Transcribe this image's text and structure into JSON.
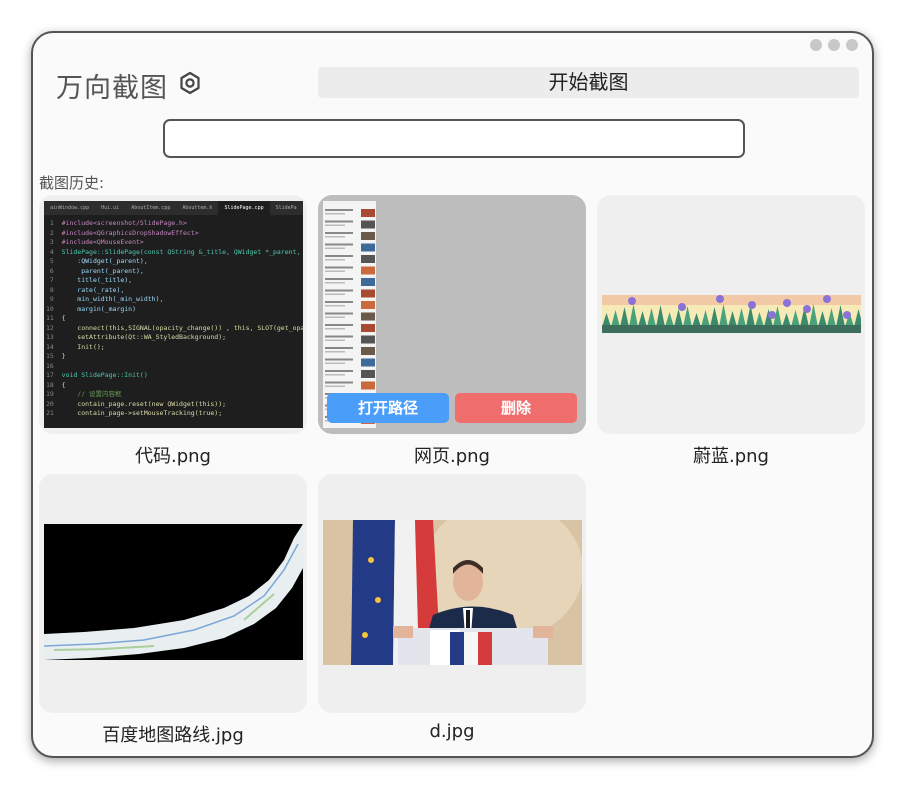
{
  "app": {
    "title": "万向截图"
  },
  "toolbar": {
    "start_label": "开始截图"
  },
  "search": {
    "value": "",
    "placeholder": ""
  },
  "history": {
    "label": "截图历史:",
    "items": [
      {
        "name": "代码.png",
        "kind": "code"
      },
      {
        "name": "网页.png",
        "kind": "webpage",
        "hovered": true
      },
      {
        "name": "蔚蓝.png",
        "kind": "game"
      },
      {
        "name": "百度地图路线.jpg",
        "kind": "map"
      },
      {
        "name": "d.jpg",
        "kind": "photo"
      }
    ],
    "open_label": "打开路径",
    "delete_label": "删除"
  },
  "code_thumb": {
    "tabs": [
      "ainWindow.cpp",
      "Hui.ui",
      "AboutItem.cpp",
      "Abouttem.h",
      "SlidePage.cpp",
      "SlidePa"
    ],
    "lines": [
      "#include<screenshot/SlidePage.h>",
      "#include<QGraphicsDropShadowEffect>",
      "#include<QMouseEvent>",
      "SlidePage::SlidePage(const QString &_title, QWidget *_parent, f",
      "    :QWidget(_parent),",
      "     parent(_parent),",
      "    title(_title),",
      "    rate(_rate),",
      "    min_width(_min_width),",
      "    margin(_margin)",
      "{",
      "    connect(this,SIGNAL(opacity_change()) , this, SLOT(get_opac",
      "    setAttribute(Qt::WA_StyledBackground);",
      "    Init();",
      "}",
      "",
      "void SlidePage::Init()",
      "{",
      "    // 设置内容框",
      "    contain_page.reset(new QWidget(this));",
      "    contain_page->setMouseTracking(true);"
    ]
  },
  "colors": {
    "open": "#4a9df8",
    "delete": "#f06d6d",
    "code_bg": "#1e1e1e"
  }
}
